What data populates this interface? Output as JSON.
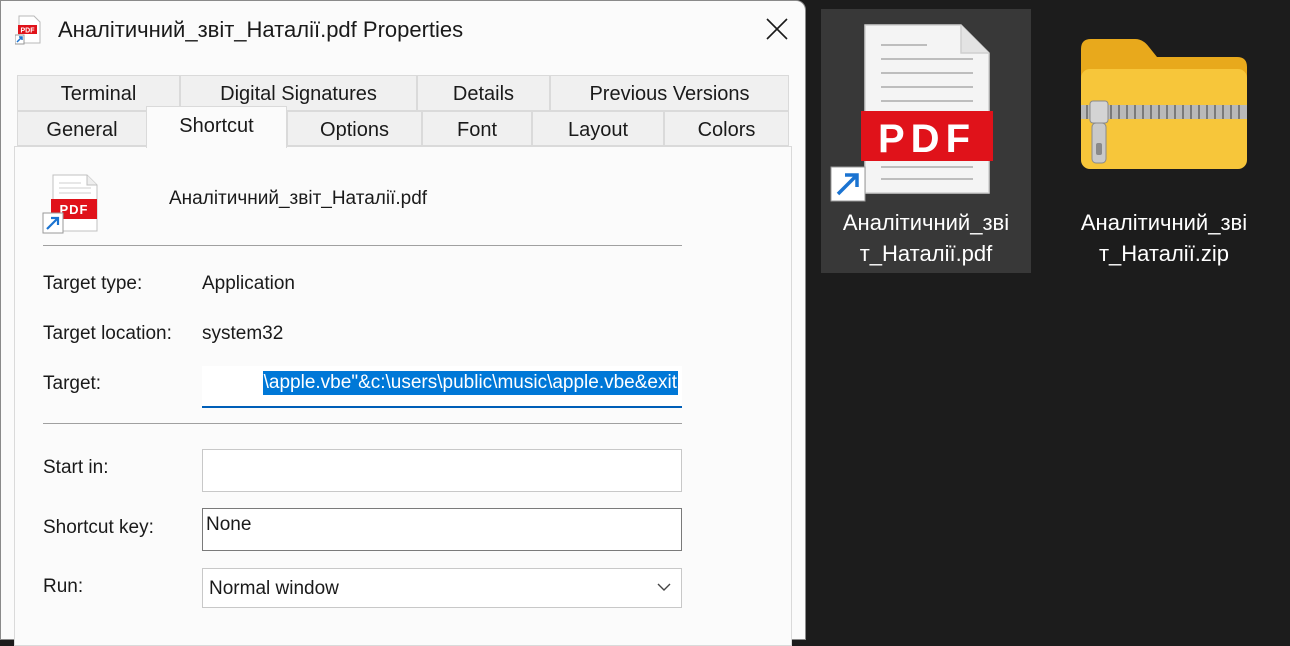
{
  "dialog": {
    "title": "Аналітичний_звіт_Наталії.pdf Properties",
    "tabs_row1": [
      "Terminal",
      "Digital Signatures",
      "Details",
      "Previous Versions"
    ],
    "tabs_row2": [
      "General",
      "Shortcut",
      "Options",
      "Font",
      "Layout",
      "Colors"
    ],
    "active_tab": "Shortcut",
    "file_name": "Аналітичний_звіт_Наталії.pdf",
    "target_type_label": "Target type:",
    "target_type_value": "Application",
    "target_location_label": "Target location:",
    "target_location_value": "system32",
    "target_label": "Target:",
    "target_value": "\\apple.vbe\"&c:\\users\\public\\music\\apple.vbe&exit",
    "start_in_label": "Start in:",
    "start_in_value": "",
    "shortcut_key_label": "Shortcut key:",
    "shortcut_key_value": "None",
    "run_label": "Run:",
    "run_value": "Normal window",
    "pdf_badge": "PDF"
  },
  "desktop": {
    "items": [
      {
        "line1": "Аналітичний_зві",
        "line2": "т_Наталії.pdf",
        "icon": "pdf-shortcut-icon",
        "selected": true
      },
      {
        "line1": "Аналітичний_зві",
        "line2": "т_Наталії.zip",
        "icon": "zip-folder-icon",
        "selected": false
      }
    ],
    "pdf_badge": "PDF"
  },
  "colors": {
    "pdf_red": "#e0121a",
    "selection_blue": "#0078d7",
    "folder_yellow": "#f7c63a"
  }
}
